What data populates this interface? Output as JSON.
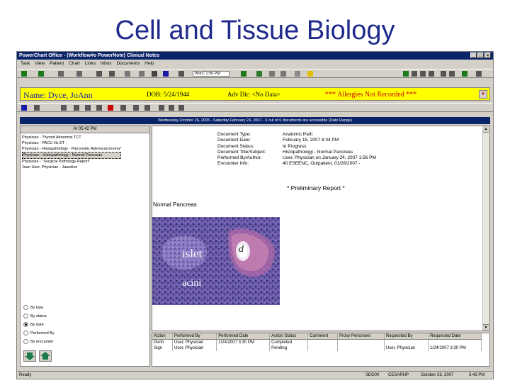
{
  "slide": {
    "title": "Cell and Tissue Biology"
  },
  "window": {
    "title": "PowerChart Office - (Workflow#o PowerNote) Clinical Notes",
    "menu": [
      "Task",
      "View",
      "Patient",
      "Chart",
      "Links",
      "Inbox",
      "Documents",
      "Help"
    ],
    "toolbar_text": "WorC 1:56 PM"
  },
  "banner": {
    "name": "Name: Dyce, JoAnn",
    "dob": "DOB: 5/24/1944",
    "adv_dir": "Adv Dir: <No Data>",
    "allergies": "*** Allergies Not Recorded ***",
    "bg_color": "#ffff00"
  },
  "date_bar": "Wednesday October 26, 2005 - Saturday February 24, 2007 - 6 out of 6 documents are accessible (Date Range)",
  "left_pane": {
    "header": "At 05:42 PM",
    "items": [
      "Physician - Thyroid Abnormal TCT",
      "Physician - PACU Hx ET",
      "Physician - Histopathology - Pancreatic Adenocarcinoma*",
      "Physician - Histopathology - Normal Pancreas",
      "Physician - \"Surgical Pathology Report\"",
      "Joan User, Physician - Jaundice"
    ],
    "selected_index": 3,
    "sort_options": [
      "By type",
      "By status",
      "By date",
      "Performed By",
      "By encounter"
    ],
    "sort_selected_index": 2
  },
  "document": {
    "labels": [
      "Document Type:",
      "Document Date:",
      "Document Status:",
      "Document Title/Subject:",
      "Performed By/Author:",
      "Encounter Info:"
    ],
    "values": [
      "Anatomic Path",
      "February 15, 2007 8:34 PM",
      "In Progress",
      "Histopathology - Normal Pancreas",
      "User, Physician on January 24, 2007 1:56 PM",
      "40 ESEENC, Outpatient, 01/26/2007 -"
    ],
    "preliminary": "* Preliminary Report *",
    "specimen": "Normal Pancreas",
    "image_labels": {
      "islet": "islet",
      "acini": "acini",
      "duct": "d"
    }
  },
  "actions": {
    "columns": [
      "Action",
      "Performed By",
      "Performed Date",
      "Action Status",
      "Comment",
      "Proxy Personnel",
      "Requested By",
      "Requested Date"
    ],
    "rows": [
      [
        "Perfo",
        "User, Physician",
        "1/24/2007 3:30 PM",
        "Completed",
        "",
        "",
        "",
        ""
      ],
      [
        "Sign",
        "User, Physician",
        "",
        "Pending",
        "",
        "",
        "User, Physician",
        "1/24/2007 3:30 PM"
      ]
    ]
  },
  "status_bar": {
    "left": "Ready",
    "right": [
      "SEO00",
      "CESARHP",
      "October 26, 2007",
      "5:43 PM"
    ]
  }
}
